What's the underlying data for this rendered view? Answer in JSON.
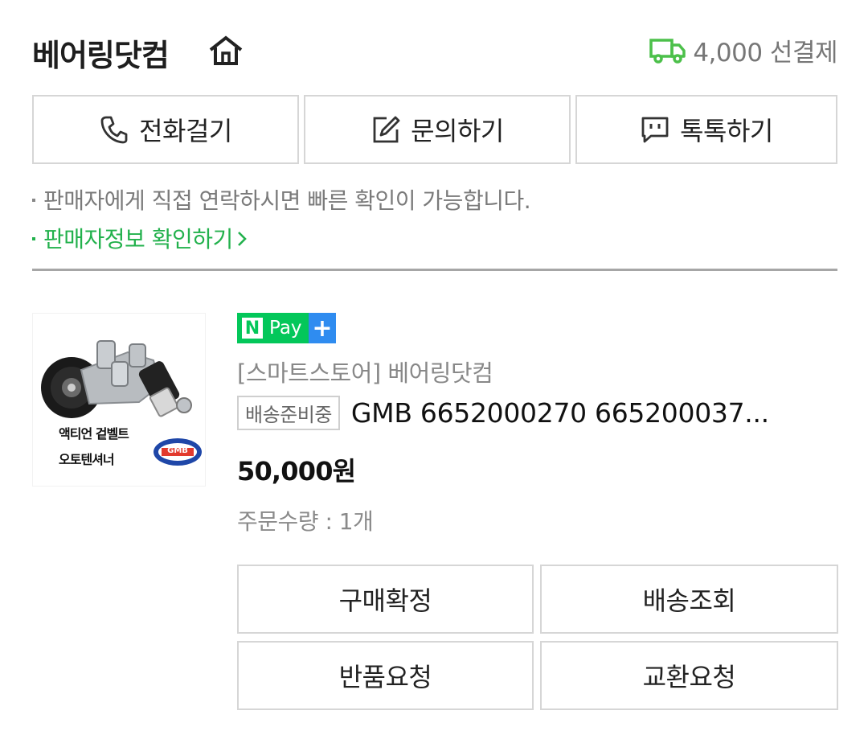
{
  "header": {
    "store_name": "베어링닷컴",
    "shipping_text": "4,000 선결제",
    "colors": {
      "truck": "#4cc04a",
      "accent_green": "#22b14c"
    },
    "icons": [
      "home-icon",
      "truck-icon"
    ]
  },
  "actions": [
    {
      "label": "전화걸기",
      "icon": "phone-icon"
    },
    {
      "label": "문의하기",
      "icon": "edit-icon"
    },
    {
      "label": "톡톡하기",
      "icon": "chat-icon"
    }
  ],
  "notes": {
    "contact_note": "판매자에게 직접 연락하시면 빠른 확인이 가능합니다.",
    "seller_info_link": "판매자정보 확인하기"
  },
  "product": {
    "thumbnail_caption_1": "액티언 겉벨트",
    "thumbnail_caption_2": "오토텐셔너",
    "thumbnail_logo": "GMB",
    "npay_label": "Pay",
    "npay_n": "N",
    "npay_plus": "+",
    "store_tag": "[스마트스토어] 베어링닷컴",
    "status": "배송준비중",
    "name": "GMB 6652000270 665200037...",
    "price": "50,000원",
    "quantity": "주문수량 : 1개"
  },
  "order_buttons": {
    "confirm": "구매확정",
    "tracking": "배송조회",
    "return": "반품요청",
    "exchange": "교환요청"
  }
}
